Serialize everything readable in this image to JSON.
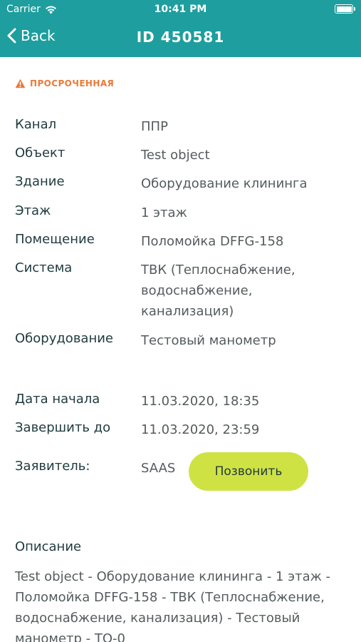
{
  "status_bar": {
    "carrier": "Carrier",
    "time": "10:41 PM",
    "wifi_icon": "wifi-icon",
    "battery_icon": "battery-icon"
  },
  "nav": {
    "back_label": "Back",
    "title": "ID 450581",
    "back_icon": "chevron-left-icon"
  },
  "warning": {
    "text": "ПРОСРОЧЕННАЯ",
    "icon": "warning-triangle-icon",
    "color": "#ea7a3a"
  },
  "details": {
    "channel": {
      "label": "Канал",
      "value": "ППР"
    },
    "object": {
      "label": "Объект",
      "value": "Test object"
    },
    "building": {
      "label": "Здание",
      "value": "Оборудование клининга"
    },
    "floor": {
      "label": "Этаж",
      "value": "1 этаж"
    },
    "room": {
      "label": "Помещение",
      "value": "Поломойка DFFG-158"
    },
    "system": {
      "label": "Система",
      "value": "ТВК (Теплоснабжение, водоснабжение, канализация)"
    },
    "equipment": {
      "label": "Оборудование",
      "value": "Тестовый манометр"
    }
  },
  "dates": {
    "start": {
      "label": "Дата начала",
      "value": "11.03.2020, 18:35"
    },
    "due": {
      "label": "Завершить до",
      "value": "11.03.2020, 23:59"
    }
  },
  "applicant": {
    "label": "Заявитель:",
    "value": "SAAS",
    "call_label": "Позвонить"
  },
  "description": {
    "title": "Описание",
    "text": "Test object - Оборудование клининга - 1 этаж - Поломойка DFFG-158 - ТВК (Теплоснабжение, водоснабжение, канализация) - Тестовый манометр - ТО-0"
  },
  "colors": {
    "header": "#1e9e9e",
    "accent_button": "#cfe244",
    "warning": "#ea7a3a"
  }
}
